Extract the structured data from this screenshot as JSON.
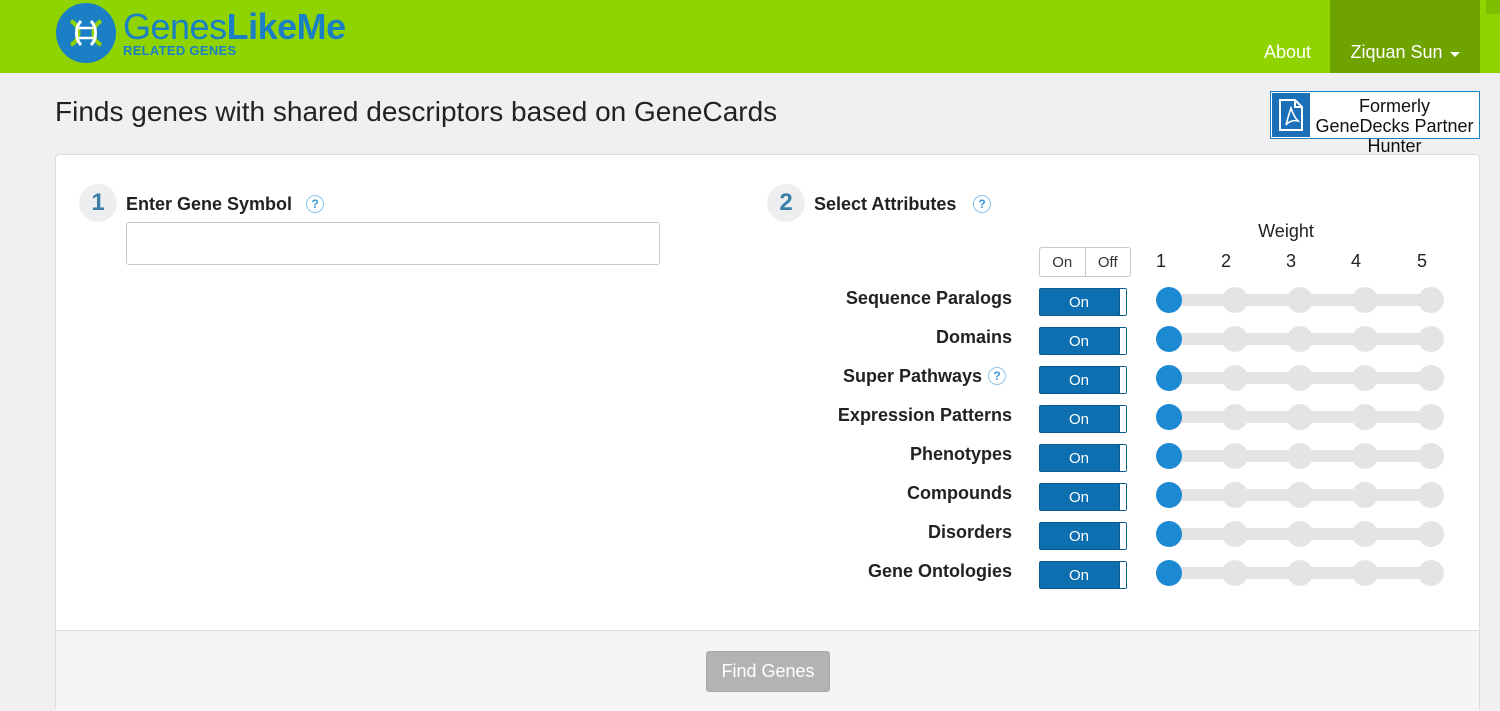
{
  "brand": {
    "name_part1": "Genes",
    "name_part2": "LikeMe",
    "tagline": "RELATED GENES",
    "blue": "#1a7fc4",
    "green": "#8fd400"
  },
  "nav": {
    "about": "About",
    "user": "Ziquan Sun"
  },
  "page": {
    "title": "Finds genes with shared descriptors based on GeneCards",
    "pdf_link": "Formerly GeneDecks Partner Hunter"
  },
  "step1": {
    "number": "1",
    "label": "Enter Gene Symbol",
    "help": "?",
    "input_value": "",
    "input_placeholder": ""
  },
  "step2": {
    "number": "2",
    "label": "Select Attributes",
    "help": "?",
    "weight_title": "Weight",
    "weight_levels": [
      "1",
      "2",
      "3",
      "4",
      "5"
    ],
    "toggle_all": {
      "on": "On",
      "off": "Off"
    },
    "attributes": [
      {
        "label": "Sequence Paralogs",
        "state": "On",
        "weight": 1,
        "help": ""
      },
      {
        "label": "Domains",
        "state": "On",
        "weight": 1,
        "help": ""
      },
      {
        "label": "Super Pathways",
        "state": "On",
        "weight": 1,
        "help": "?"
      },
      {
        "label": "Expression Patterns",
        "state": "On",
        "weight": 1,
        "help": ""
      },
      {
        "label": "Phenotypes",
        "state": "On",
        "weight": 1,
        "help": ""
      },
      {
        "label": "Compounds",
        "state": "On",
        "weight": 1,
        "help": ""
      },
      {
        "label": "Disorders",
        "state": "On",
        "weight": 1,
        "help": ""
      },
      {
        "label": "Gene Ontologies",
        "state": "On",
        "weight": 1,
        "help": ""
      }
    ]
  },
  "footer": {
    "find_button": "Find Genes"
  }
}
